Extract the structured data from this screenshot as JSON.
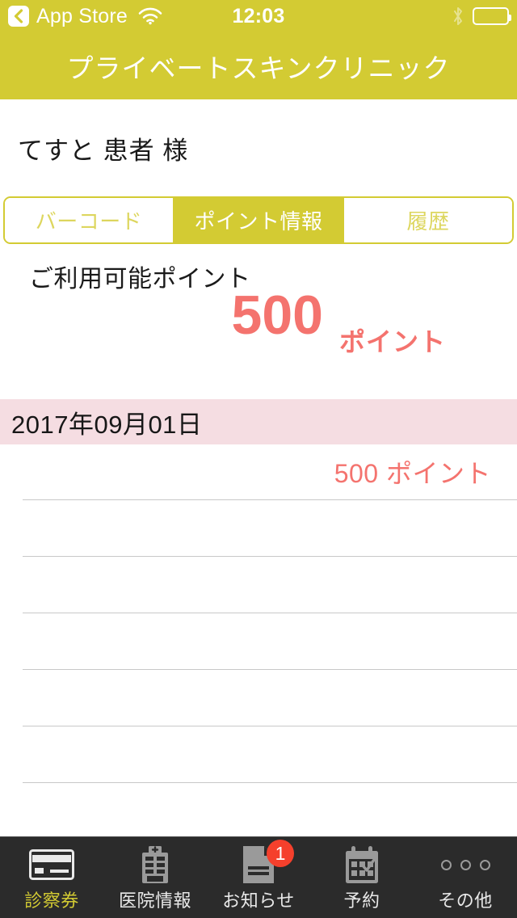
{
  "status_bar": {
    "back_label": "App Store",
    "back_icon": "chevron-left-icon",
    "wifi_icon": "wifi-icon",
    "time": "12:03",
    "bluetooth_icon": "bluetooth-icon",
    "battery_icon": "battery-full-icon",
    "battery_level": 100
  },
  "nav": {
    "title": "プライベートスキンクリニック",
    "background": "#d3cb33"
  },
  "patient": {
    "name": "てすと 患者 様"
  },
  "segmented": {
    "tabs": [
      {
        "label": "バーコード",
        "active": false
      },
      {
        "label": "ポイント情報",
        "active": true
      },
      {
        "label": "履歴",
        "active": false
      }
    ],
    "accent": "#d3cb33",
    "inactive_text": "#ddd65e"
  },
  "points": {
    "label": "ご利用可能ポイント",
    "value": "500",
    "unit": "ポイント",
    "color": "#f4736e"
  },
  "history": {
    "date_header": "2017年09月01日",
    "date_header_bg": "#f5dde2",
    "entries": [
      {
        "amount": "500 ポイント"
      }
    ],
    "empty_rows": 5
  },
  "tabbar": {
    "background": "#2b2b2b",
    "active_color": "#d3cb33",
    "items": [
      {
        "label": "診察券",
        "icon": "card-icon",
        "active": true,
        "badge": null
      },
      {
        "label": "医院情報",
        "icon": "hospital-icon",
        "active": false,
        "badge": null
      },
      {
        "label": "お知らせ",
        "icon": "document-icon",
        "active": false,
        "badge": "1"
      },
      {
        "label": "予約",
        "icon": "calendar-check-icon",
        "active": false,
        "badge": null
      },
      {
        "label": "その他",
        "icon": "more-dots-icon",
        "active": false,
        "badge": null
      }
    ]
  }
}
